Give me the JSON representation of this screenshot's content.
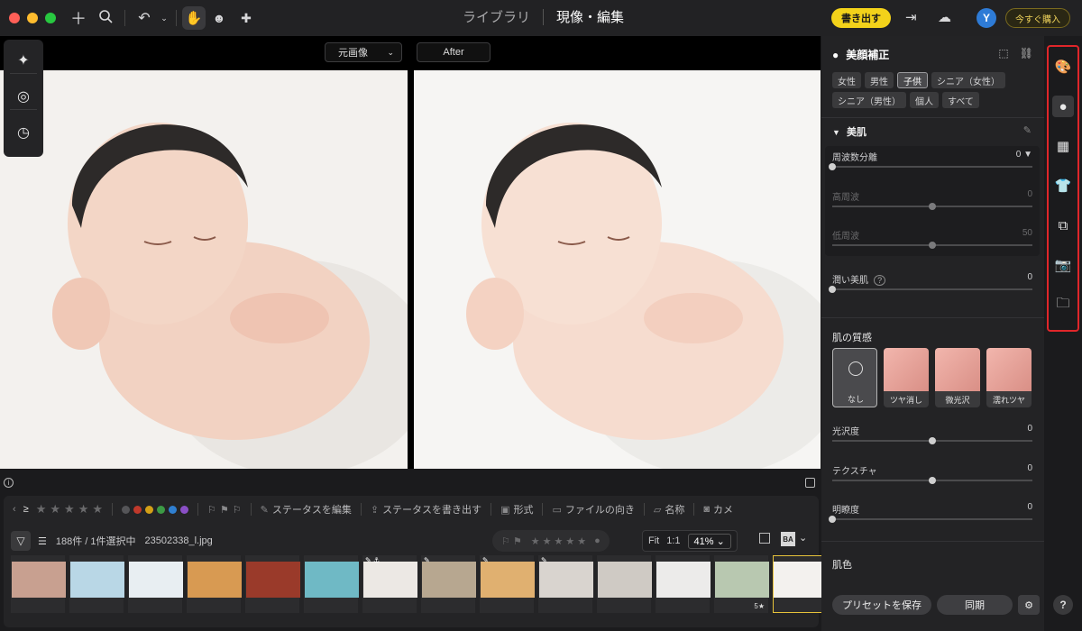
{
  "window": {
    "traffic_colors": [
      "#ff5f57",
      "#febc2e",
      "#28c840"
    ]
  },
  "nav": {
    "tabs": [
      {
        "label": "ライブラリ"
      },
      {
        "label": "現像・編集",
        "active": true
      }
    ]
  },
  "toolbar": {
    "export_label": "書き出す",
    "avatar_initial": "Y",
    "buy_label": "今すぐ購入"
  },
  "viewer": {
    "original_select_label": "元画像",
    "after_label": "After"
  },
  "filmstrip": {
    "toolbar": {
      "ge_symbol": "≥",
      "status_edit": "ステータスを編集",
      "status_export": "ステータスを書き出す",
      "format": "形式",
      "orientation": "ファイルの向き",
      "name": "名称",
      "camera": "カメ"
    },
    "color_labels": [
      "#555558",
      "#c0392b",
      "#d4a017",
      "#3c9a45",
      "#2f7fd0",
      "#8a4fc6"
    ],
    "count_text": "188件 / 1件選択中",
    "filename": "23502338_l.jpg",
    "zoom": {
      "fit": "Fit",
      "one_to_one": "1:1",
      "value": "41%"
    },
    "thumbnails": [
      {
        "color": "#c8a090",
        "badge": ""
      },
      {
        "color": "#b9d7e6",
        "badge": ""
      },
      {
        "color": "#e8eef2",
        "badge": ""
      },
      {
        "color": "#d89a52",
        "badge": ""
      },
      {
        "color": "#9a3a2a",
        "badge": ""
      },
      {
        "color": "#6fb9c5",
        "badge": ""
      },
      {
        "color": "#ece8e4",
        "badge": "✎ ⚓"
      },
      {
        "color": "#b7a790",
        "badge": "✎"
      },
      {
        "color": "#e0b070",
        "badge": "✎"
      },
      {
        "color": "#d9d4cf",
        "badge": "✎"
      },
      {
        "color": "#cfcac4",
        "badge": ""
      },
      {
        "color": "#ecebea",
        "badge": ""
      },
      {
        "color": "#b8c8b0",
        "badge": "",
        "stars": "5★"
      },
      {
        "color": "#f3f1ee",
        "badge": "",
        "selected": true
      }
    ]
  },
  "panel": {
    "title": "美顔補正",
    "chips": [
      {
        "label": "女性"
      },
      {
        "label": "男性"
      },
      {
        "label": "子供",
        "active": true
      },
      {
        "label": "シニア（女性）"
      },
      {
        "label": "シニア（男性）"
      },
      {
        "label": "個人"
      },
      {
        "label": "すべて"
      }
    ],
    "skin_section": "美肌",
    "freq_separation": {
      "label": "周波数分離",
      "value": "0"
    },
    "high_freq": {
      "label": "高周波",
      "value": "0"
    },
    "low_freq": {
      "label": "低周波",
      "value": "50"
    },
    "moist_skin": {
      "label": "潤い美肌",
      "value": "0"
    },
    "texture_title": "肌の質感",
    "textures": [
      "なし",
      "ツヤ消し",
      "微光沢",
      "濡れツヤ"
    ],
    "gloss": {
      "label": "光沢度",
      "value": "0"
    },
    "texture": {
      "label": "テクスチャ",
      "value": "0"
    },
    "clarity": {
      "label": "明瞭度",
      "value": "0"
    },
    "skin_color_title": "肌色",
    "save_preset": "プリセットを保存",
    "sync": "同期"
  },
  "sliders": {
    "freq_separation": 0,
    "high_freq": 0.5,
    "low_freq": 0.5,
    "moist_skin": 0,
    "gloss": 0.5,
    "texture": 0.5,
    "clarity": 0
  },
  "help_label": "?"
}
